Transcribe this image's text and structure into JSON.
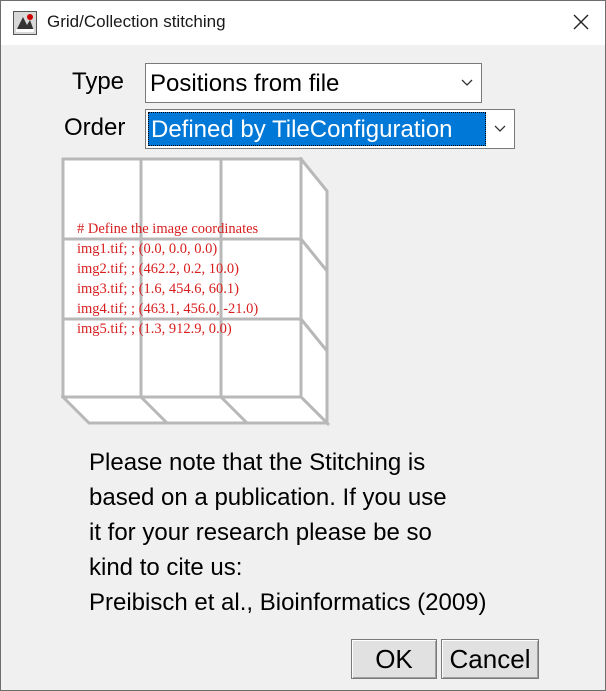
{
  "window": {
    "title": "Grid/Collection stitching"
  },
  "form": {
    "type_label": "Type",
    "type_value": "Positions from file",
    "order_label": "Order",
    "order_value": "Defined by TileConfiguration"
  },
  "diagram": {
    "lines": [
      "# Define the image coordinates",
      "img1.tif; ; (0.0, 0.0, 0.0)",
      "img2.tif; ; (462.2, 0.2, 10.0)",
      "img3.tif; ; (1.6, 454.6, 60.1)",
      "img4.tif; ; (463.1, 456.0, -21.0)",
      "img5.tif; ; (1.3, 912.9, 0.0)"
    ],
    "text_color": "#d81e1e"
  },
  "note": {
    "lines": [
      "Please note that the Stitching is",
      "based on a publication. If you use",
      "it for your research please be so",
      "kind to cite us:",
      "Preibisch et al., Bioinformatics (2009)"
    ]
  },
  "buttons": {
    "ok": "OK",
    "cancel": "Cancel"
  },
  "colors": {
    "selection": "#0078d7",
    "dialog_bg": "#f0f0f0"
  }
}
